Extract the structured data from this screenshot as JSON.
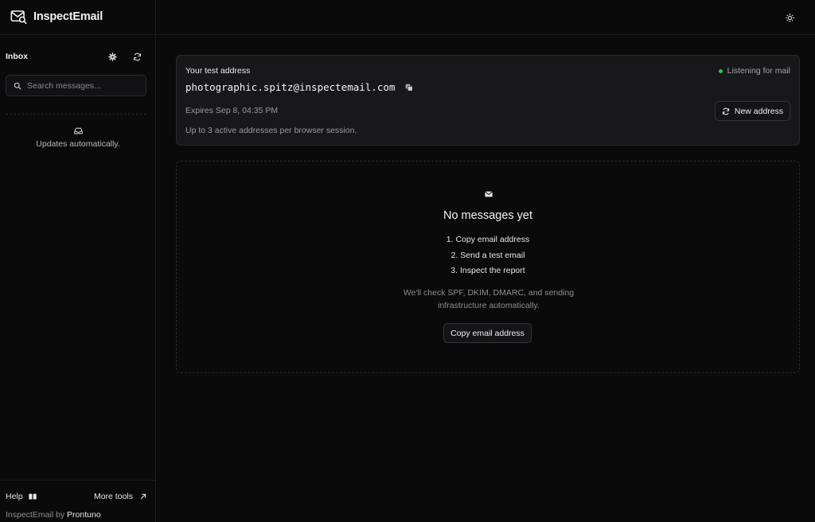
{
  "app": {
    "name": "InspectEmail"
  },
  "sidebar": {
    "title": "Inbox",
    "search_placeholder": "Search messages...",
    "empty_text": "Updates automatically.",
    "footer": {
      "help_label": "Help",
      "more_tools_label": "More tools",
      "credit_prefix": "InspectEmail by",
      "credit_maker": "Prontuno"
    }
  },
  "address_card": {
    "label": "Your test address",
    "status": "Listening for mail",
    "status_color": "#22c55e",
    "address": "photographic.spitz@inspectemail.com",
    "expires": "Expires Sep 8, 04:35 PM",
    "note": "Up to 3 active addresses per browser session.",
    "new_address_label": "New address"
  },
  "empty_state": {
    "title": "No messages yet",
    "steps": [
      "1. Copy email address",
      "2. Send a test email",
      "3. Inspect the report"
    ],
    "description": "We'll check SPF, DKIM, DMARC, and sending infrastructure automatically.",
    "copy_button_label": "Copy email address"
  },
  "icons": {
    "logo": "envelope-search-icon",
    "theme": "sun-icon",
    "settings": "gear-icon",
    "refresh": "refresh-icon",
    "search": "search-icon",
    "inbox": "inbox-tray-icon",
    "help": "book-icon",
    "external": "arrow-up-right-icon",
    "copy": "copy-icon",
    "empty": "envelope-icon"
  }
}
